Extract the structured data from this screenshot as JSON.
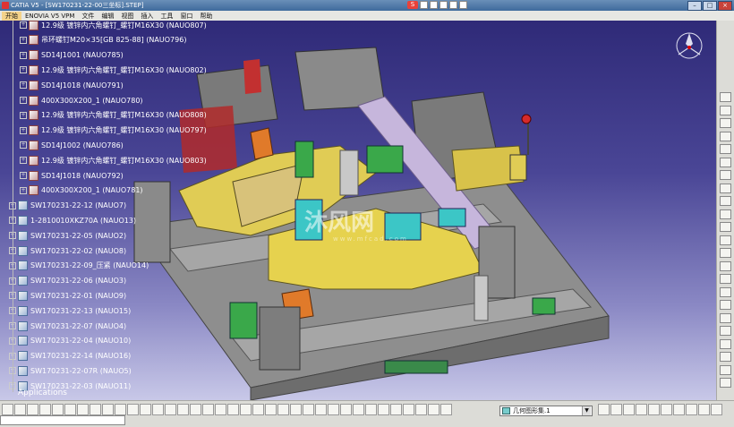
{
  "window": {
    "title": "CATIA V5 - [SW170231-22-00三坐标].STEP]",
    "minimize": "–",
    "maximize": "□",
    "close": "×"
  },
  "ime": {
    "label": "S"
  },
  "menu": {
    "items": [
      "开始",
      "ENOVIA V5 VPM",
      "文件",
      "编辑",
      "视图",
      "插入",
      "工具",
      "窗口",
      "帮助"
    ]
  },
  "tree": {
    "nodes": [
      {
        "label": "12.9级 镀锌内六角螺钉_螺钉M16X30 (NAUO807)",
        "type": "part",
        "indent": 2
      },
      {
        "label": "吊环螺钉M20×35[GB 825-88] (NAUO796)",
        "type": "part",
        "indent": 2
      },
      {
        "label": "SD14J1001 (NAUO785)",
        "type": "part",
        "indent": 2
      },
      {
        "label": "12.9级 镀锌内六角螺钉_螺钉M16X30 (NAUO802)",
        "type": "part",
        "indent": 2
      },
      {
        "label": "SD14J1018 (NAUO791)",
        "type": "part",
        "indent": 2
      },
      {
        "label": "400X300X200_1 (NAUO780)",
        "type": "part",
        "indent": 2
      },
      {
        "label": "12.9级 镀锌内六角螺钉_螺钉M16X30 (NAUO808)",
        "type": "part",
        "indent": 2
      },
      {
        "label": "12.9级 镀锌内六角螺钉_螺钉M16X30 (NAUO797)",
        "type": "part",
        "indent": 2
      },
      {
        "label": "SD14J1002 (NAUO786)",
        "type": "part",
        "indent": 2
      },
      {
        "label": "12.9级 镀锌内六角螺钉_螺钉M16X30 (NAUO803)",
        "type": "part",
        "indent": 2
      },
      {
        "label": "SD14J1018 (NAUO792)",
        "type": "part",
        "indent": 2
      },
      {
        "label": "400X300X200_1 (NAUO781)",
        "type": "part",
        "indent": 2
      },
      {
        "label": "SW170231-22-12 (NAUO7)",
        "type": "product",
        "indent": 1
      },
      {
        "label": "1-2810010XKZ70A (NAUO13)",
        "type": "product",
        "indent": 1
      },
      {
        "label": "SW170231-22-05 (NAUO2)",
        "type": "product",
        "indent": 1
      },
      {
        "label": "SW170231-22-02 (NAUO8)",
        "type": "product",
        "indent": 1
      },
      {
        "label": "SW170231-22-09_压紧 (NAUO14)",
        "type": "product",
        "indent": 1
      },
      {
        "label": "SW170231-22-06 (NAUO3)",
        "type": "product",
        "indent": 1
      },
      {
        "label": "SW170231-22-01 (NAUO9)",
        "type": "product",
        "indent": 1
      },
      {
        "label": "SW170231-22-13 (NAUO15)",
        "type": "product",
        "indent": 1
      },
      {
        "label": "SW170231-22-07 (NAUO4)",
        "type": "product",
        "indent": 1
      },
      {
        "label": "SW170231-22-04 (NAUO10)",
        "type": "product",
        "indent": 1
      },
      {
        "label": "SW170231-22-14 (NAUO16)",
        "type": "product",
        "indent": 1
      },
      {
        "label": "SW170231-22-07R (NAUO5)",
        "type": "product",
        "indent": 1
      },
      {
        "label": "SW170231-22-03 (NAUO11)",
        "type": "product",
        "indent": 1
      }
    ],
    "applications_label": "Applications"
  },
  "watermark": {
    "main": "沐风网",
    "sub": "www.mfcad.com"
  },
  "bottom": {
    "geometry_set_dropdown": "几何图形集.1"
  },
  "colors": {
    "viewport_top": "#2f2a78",
    "viewport_bottom": "#c8c8e8",
    "fixture_gray": "#8e8e8e",
    "part_yellow": "#e8d34a",
    "pipe_lavender": "#c6b6dc",
    "cyan": "#3cc6c6",
    "green": "#3aa84a",
    "orange": "#e07a2a",
    "red": "#d52a2a"
  }
}
